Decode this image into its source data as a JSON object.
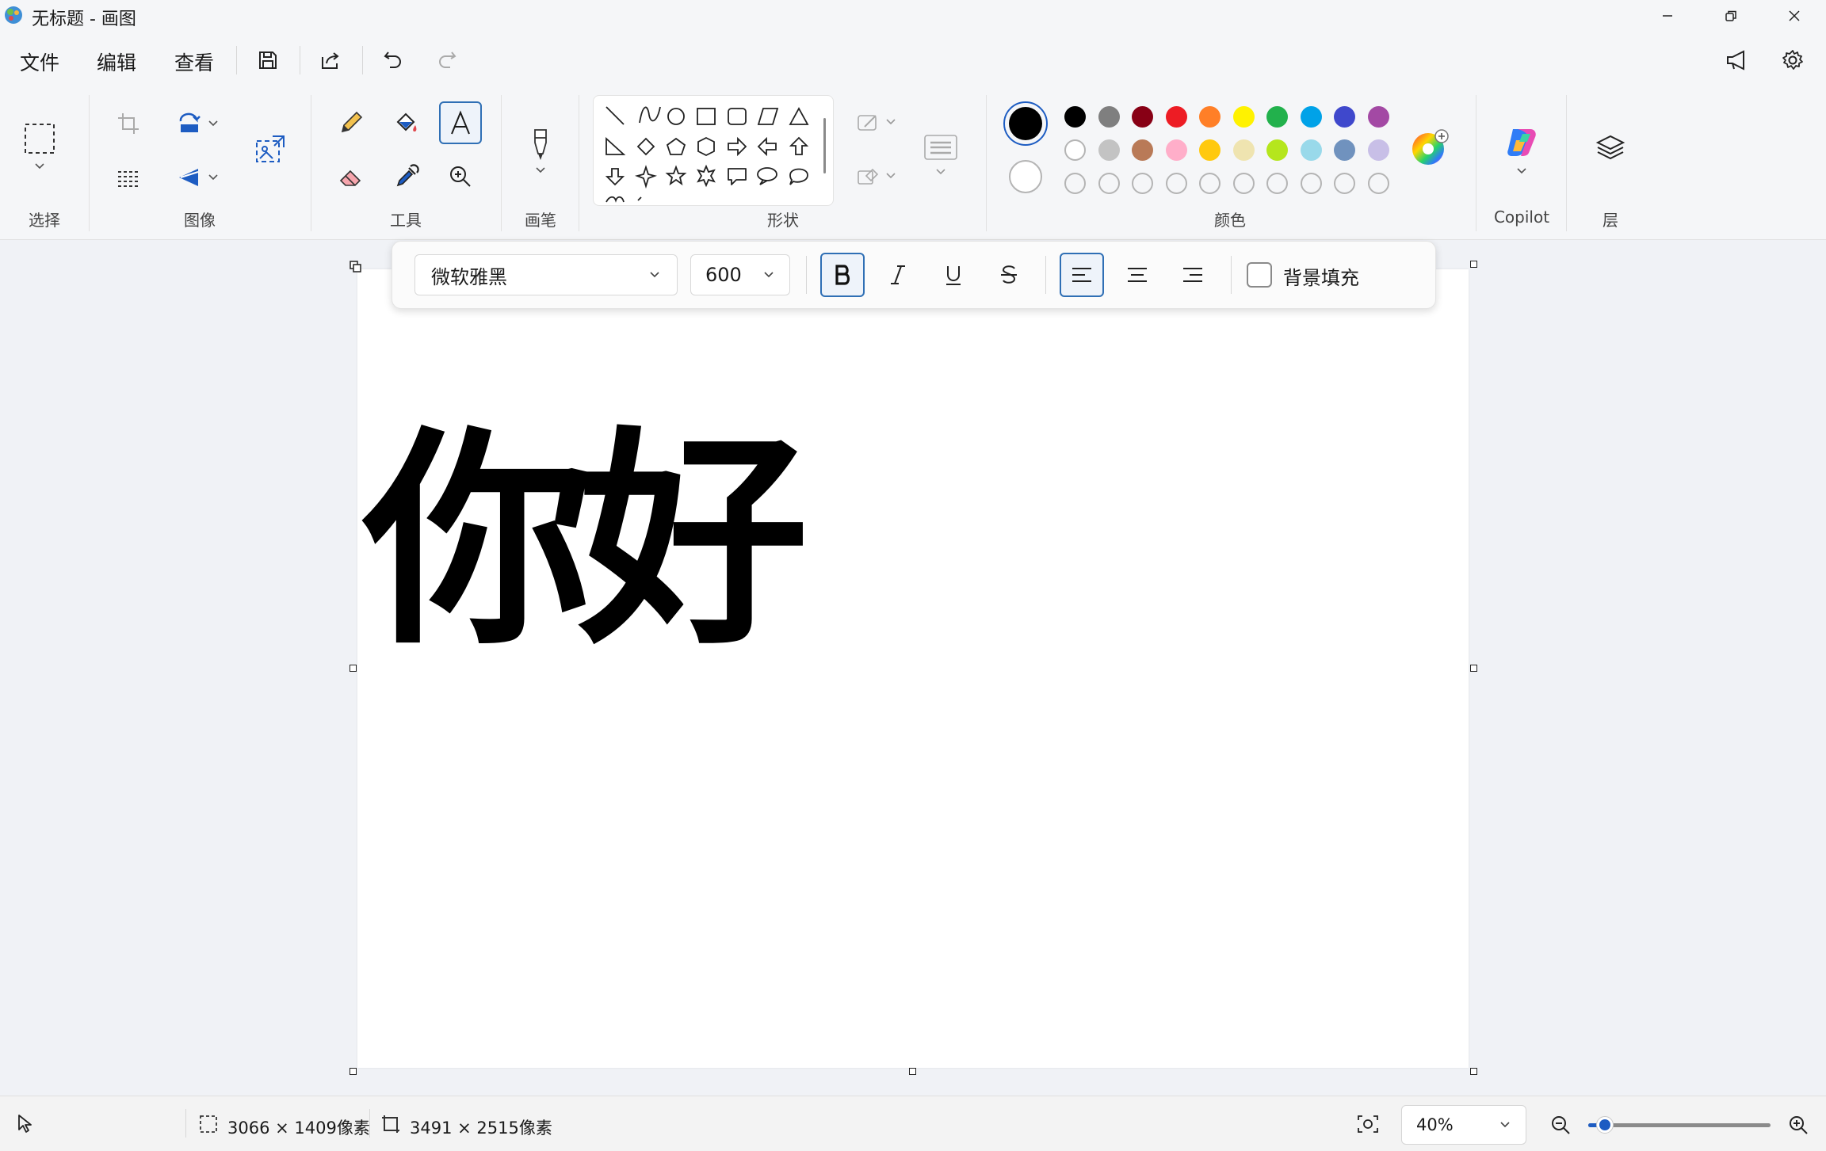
{
  "window": {
    "title": "无标题 - 画图"
  },
  "menu": {
    "file": "文件",
    "edit": "编辑",
    "view": "查看"
  },
  "ribbon": {
    "select_label": "选择",
    "image_label": "图像",
    "tools_label": "工具",
    "brush_label": "画笔",
    "shapes_label": "形状",
    "colors_label": "颜色",
    "copilot_label": "Copilot",
    "layers_label": "层"
  },
  "colors": {
    "primary": "#000000",
    "secondary": "#ffffff",
    "palette_row1": [
      "#000000",
      "#7f7f7f",
      "#880015",
      "#ed1c24",
      "#ff7f27",
      "#fff200",
      "#22b14c",
      "#00a2e8",
      "#3f48cc",
      "#a349a4"
    ],
    "palette_row2": [
      "#ffffff",
      "#c3c3c3",
      "#b97a57",
      "#ffaec9",
      "#ffc90e",
      "#efe4b0",
      "#b5e61d",
      "#99d9ea",
      "#7092be",
      "#c8bfe7"
    ],
    "custom_empty_count": 10
  },
  "text_toolbar": {
    "font": "微软雅黑",
    "size": "600",
    "bold": true,
    "italic": false,
    "underline": false,
    "strikethrough": false,
    "align": "left",
    "background_fill_label": "背景填充",
    "background_fill": false
  },
  "canvas": {
    "text": "你好"
  },
  "status": {
    "selection_size": "3066 × 1409像素",
    "canvas_size": "3491 × 2515像素",
    "zoom": "40%",
    "zoom_fraction": 0.05
  }
}
